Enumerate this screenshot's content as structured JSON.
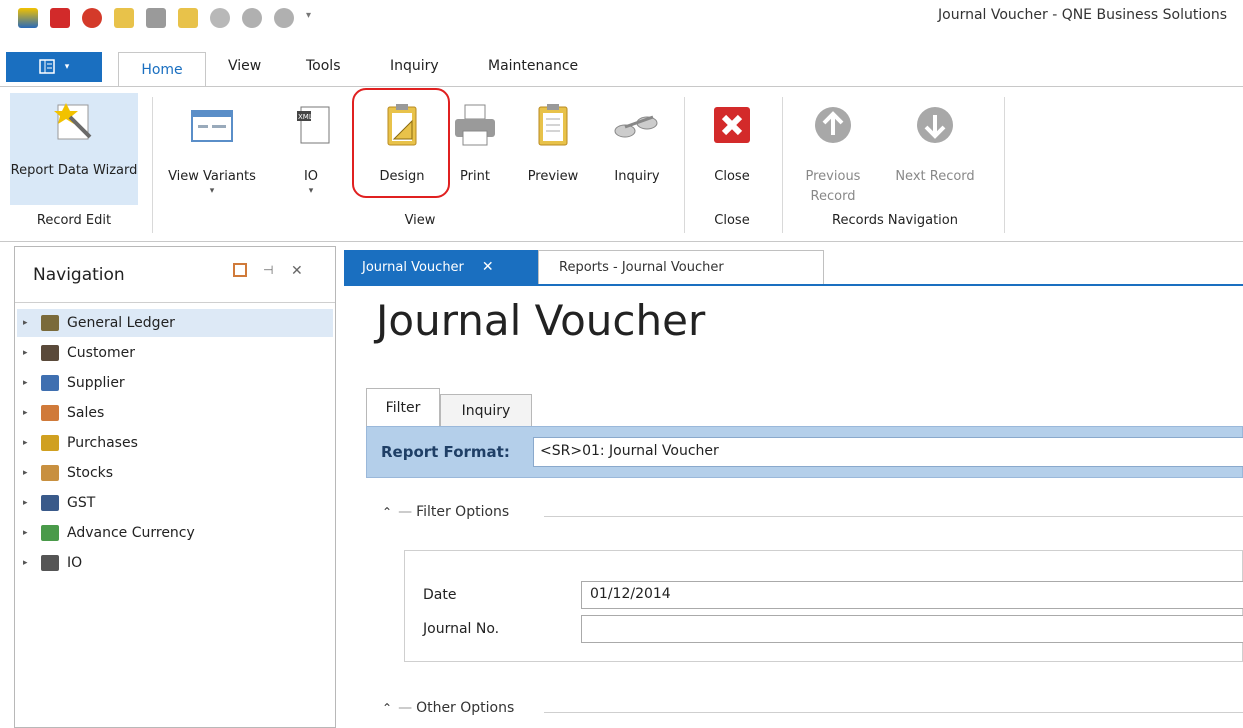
{
  "window": {
    "title": "Journal Voucher - QNE Business Solutions"
  },
  "quick_access": [
    "qne-logo-icon",
    "pdf-icon",
    "power-icon",
    "design-icon",
    "print-icon",
    "preview-icon",
    "inquiry-icon",
    "up-icon",
    "down-icon",
    "customize-icon"
  ],
  "ribbon_tabs": {
    "home": "Home",
    "view": "View",
    "tools": "Tools",
    "inquiry": "Inquiry",
    "maintenance": "Maintenance"
  },
  "ribbon": {
    "report_data_wizard": "Report Data Wizard",
    "view_variants": "View Variants",
    "io": "IO",
    "design": "Design",
    "print": "Print",
    "preview": "Preview",
    "inquiry": "Inquiry",
    "close": "Close",
    "previous_record": "Previous Record",
    "next_record": "Next Record",
    "groups": {
      "record_edit": "Record Edit",
      "view": "View",
      "close": "Close",
      "records_navigation": "Records Navigation"
    }
  },
  "navigation": {
    "title": "Navigation",
    "items": [
      {
        "label": "General Ledger",
        "icon": "general-ledger-icon",
        "color": "#7a6a3a"
      },
      {
        "label": "Customer",
        "icon": "customer-icon",
        "color": "#5a4a3a"
      },
      {
        "label": "Supplier",
        "icon": "supplier-icon",
        "color": "#3f6fb0"
      },
      {
        "label": "Sales",
        "icon": "sales-icon",
        "color": "#d07a3a"
      },
      {
        "label": "Purchases",
        "icon": "purchases-icon",
        "color": "#d0a020"
      },
      {
        "label": "Stocks",
        "icon": "stocks-icon",
        "color": "#c89040"
      },
      {
        "label": "GST",
        "icon": "gst-icon",
        "color": "#3a5a8a"
      },
      {
        "label": "Advance Currency",
        "icon": "currency-icon",
        "color": "#4a9a4a"
      },
      {
        "label": "IO",
        "icon": "io-icon",
        "color": "#555555"
      }
    ]
  },
  "doc_tabs": {
    "active": "Journal Voucher",
    "second": "Reports - Journal Voucher"
  },
  "page": {
    "title": "Journal Voucher",
    "sub_tabs": {
      "filter": "Filter",
      "inquiry": "Inquiry"
    },
    "report_format_label": "Report Format:",
    "report_format_value": "<SR>01: Journal Voucher",
    "filter_options_label": "Filter Options",
    "date_label": "Date",
    "date_value": "01/12/2014",
    "journal_no_label": "Journal No.",
    "journal_no_value": "",
    "other_options_label": "Other Options"
  },
  "colors": {
    "accent": "#1a6fc0",
    "highlight": "#e02020",
    "format_bar": "#b4cfea"
  }
}
